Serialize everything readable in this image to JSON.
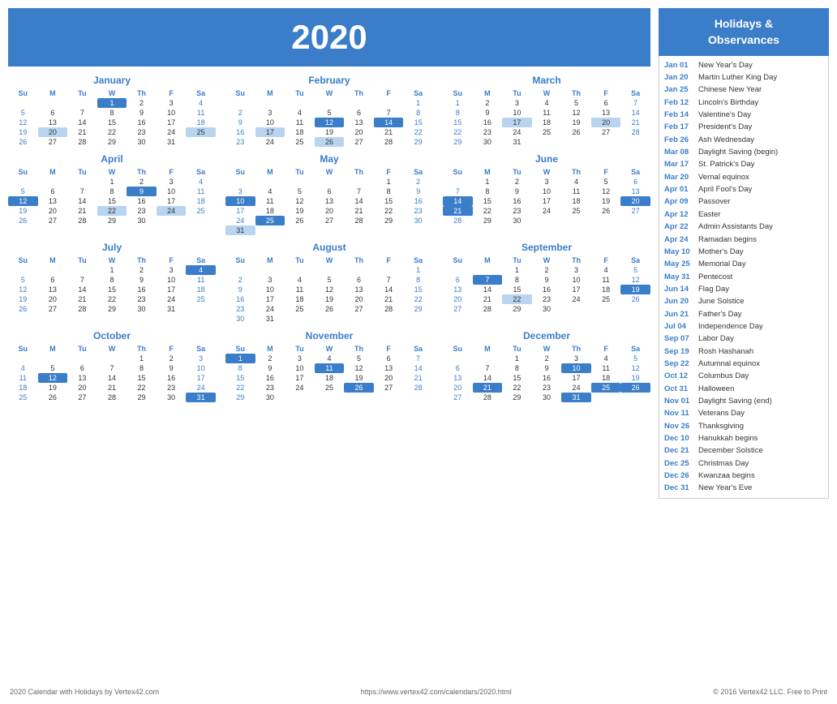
{
  "year": "2020",
  "months": [
    {
      "name": "January",
      "days": [
        {
          "week": [
            null,
            null,
            null,
            1,
            2,
            3,
            4
          ]
        },
        {
          "week": [
            5,
            6,
            7,
            8,
            9,
            10,
            11
          ]
        },
        {
          "week": [
            12,
            13,
            14,
            15,
            16,
            17,
            18
          ]
        },
        {
          "week": [
            19,
            20,
            21,
            22,
            23,
            24,
            25
          ]
        },
        {
          "week": [
            26,
            27,
            28,
            29,
            30,
            31,
            null
          ]
        }
      ],
      "highlights": {
        "blue": [
          1
        ],
        "light": [
          20,
          25
        ]
      }
    },
    {
      "name": "February",
      "days": [
        {
          "week": [
            null,
            null,
            null,
            null,
            null,
            null,
            1
          ]
        },
        {
          "week": [
            2,
            3,
            4,
            5,
            6,
            7,
            8
          ]
        },
        {
          "week": [
            9,
            10,
            11,
            12,
            13,
            14,
            15
          ]
        },
        {
          "week": [
            16,
            17,
            18,
            19,
            20,
            21,
            22
          ]
        },
        {
          "week": [
            23,
            24,
            25,
            26,
            27,
            28,
            29
          ]
        }
      ],
      "highlights": {
        "blue": [
          12,
          14
        ],
        "light": [
          17,
          26
        ]
      }
    },
    {
      "name": "March",
      "days": [
        {
          "week": [
            1,
            2,
            3,
            4,
            5,
            6,
            7
          ]
        },
        {
          "week": [
            8,
            9,
            10,
            11,
            12,
            13,
            14
          ]
        },
        {
          "week": [
            15,
            16,
            17,
            18,
            19,
            20,
            21
          ]
        },
        {
          "week": [
            22,
            23,
            24,
            25,
            26,
            27,
            28
          ]
        },
        {
          "week": [
            29,
            30,
            31,
            null,
            null,
            null,
            null
          ]
        }
      ],
      "highlights": {
        "blue": [],
        "light": [
          17,
          20
        ]
      }
    },
    {
      "name": "April",
      "days": [
        {
          "week": [
            null,
            null,
            null,
            1,
            2,
            3,
            4
          ]
        },
        {
          "week": [
            5,
            6,
            7,
            8,
            9,
            10,
            11
          ]
        },
        {
          "week": [
            12,
            13,
            14,
            15,
            16,
            17,
            18
          ]
        },
        {
          "week": [
            19,
            20,
            21,
            22,
            23,
            24,
            25
          ]
        },
        {
          "week": [
            26,
            27,
            28,
            29,
            30,
            null,
            null
          ]
        }
      ],
      "highlights": {
        "blue": [
          9,
          12
        ],
        "light": [
          22,
          24
        ]
      }
    },
    {
      "name": "May",
      "days": [
        {
          "week": [
            null,
            null,
            null,
            null,
            null,
            1,
            2
          ]
        },
        {
          "week": [
            3,
            4,
            5,
            6,
            7,
            8,
            9
          ]
        },
        {
          "week": [
            10,
            11,
            12,
            13,
            14,
            15,
            16
          ]
        },
        {
          "week": [
            17,
            18,
            19,
            20,
            21,
            22,
            23
          ]
        },
        {
          "week": [
            24,
            25,
            26,
            27,
            28,
            29,
            30
          ]
        },
        {
          "week": [
            31,
            null,
            null,
            null,
            null,
            null,
            null
          ]
        }
      ],
      "highlights": {
        "blue": [
          10,
          25
        ],
        "light": [
          31
        ]
      }
    },
    {
      "name": "June",
      "days": [
        {
          "week": [
            null,
            1,
            2,
            3,
            4,
            5,
            6
          ]
        },
        {
          "week": [
            7,
            8,
            9,
            10,
            11,
            12,
            13
          ]
        },
        {
          "week": [
            14,
            15,
            16,
            17,
            18,
            19,
            20
          ]
        },
        {
          "week": [
            21,
            22,
            23,
            24,
            25,
            26,
            27
          ]
        },
        {
          "week": [
            28,
            29,
            30,
            null,
            null,
            null,
            null
          ]
        }
      ],
      "highlights": {
        "blue": [
          14,
          20,
          21
        ],
        "light": []
      }
    },
    {
      "name": "July",
      "days": [
        {
          "week": [
            null,
            null,
            null,
            1,
            2,
            3,
            4
          ]
        },
        {
          "week": [
            5,
            6,
            7,
            8,
            9,
            10,
            11
          ]
        },
        {
          "week": [
            12,
            13,
            14,
            15,
            16,
            17,
            18
          ]
        },
        {
          "week": [
            19,
            20,
            21,
            22,
            23,
            24,
            25
          ]
        },
        {
          "week": [
            26,
            27,
            28,
            29,
            30,
            31,
            null
          ]
        }
      ],
      "highlights": {
        "blue": [
          4
        ],
        "light": []
      }
    },
    {
      "name": "August",
      "days": [
        {
          "week": [
            null,
            null,
            null,
            null,
            null,
            null,
            1
          ]
        },
        {
          "week": [
            2,
            3,
            4,
            5,
            6,
            7,
            8
          ]
        },
        {
          "week": [
            9,
            10,
            11,
            12,
            13,
            14,
            15
          ]
        },
        {
          "week": [
            16,
            17,
            18,
            19,
            20,
            21,
            22
          ]
        },
        {
          "week": [
            23,
            24,
            25,
            26,
            27,
            28,
            29
          ]
        },
        {
          "week": [
            30,
            31,
            null,
            null,
            null,
            null,
            null
          ]
        }
      ],
      "highlights": {
        "blue": [],
        "light": []
      }
    },
    {
      "name": "September",
      "days": [
        {
          "week": [
            null,
            null,
            1,
            2,
            3,
            4,
            5
          ]
        },
        {
          "week": [
            6,
            7,
            8,
            9,
            10,
            11,
            12
          ]
        },
        {
          "week": [
            13,
            14,
            15,
            16,
            17,
            18,
            19
          ]
        },
        {
          "week": [
            20,
            21,
            22,
            23,
            24,
            25,
            26
          ]
        },
        {
          "week": [
            27,
            28,
            29,
            30,
            null,
            null,
            null
          ]
        }
      ],
      "highlights": {
        "blue": [
          7,
          19
        ],
        "light": [
          22
        ]
      }
    },
    {
      "name": "October",
      "days": [
        {
          "week": [
            null,
            null,
            null,
            null,
            1,
            2,
            3
          ]
        },
        {
          "week": [
            4,
            5,
            6,
            7,
            8,
            9,
            10
          ]
        },
        {
          "week": [
            11,
            12,
            13,
            14,
            15,
            16,
            17
          ]
        },
        {
          "week": [
            18,
            19,
            20,
            21,
            22,
            23,
            24
          ]
        },
        {
          "week": [
            25,
            26,
            27,
            28,
            29,
            30,
            31
          ]
        }
      ],
      "highlights": {
        "blue": [
          12,
          31
        ],
        "light": []
      }
    },
    {
      "name": "November",
      "days": [
        {
          "week": [
            1,
            2,
            3,
            4,
            5,
            6,
            7
          ]
        },
        {
          "week": [
            8,
            9,
            10,
            11,
            12,
            13,
            14
          ]
        },
        {
          "week": [
            15,
            16,
            17,
            18,
            19,
            20,
            21
          ]
        },
        {
          "week": [
            22,
            23,
            24,
            25,
            26,
            27,
            28
          ]
        },
        {
          "week": [
            29,
            30,
            null,
            null,
            null,
            null,
            null
          ]
        }
      ],
      "highlights": {
        "blue": [
          1,
          11,
          26
        ],
        "light": [
          26
        ]
      }
    },
    {
      "name": "December",
      "days": [
        {
          "week": [
            null,
            null,
            1,
            2,
            3,
            4,
            5
          ]
        },
        {
          "week": [
            6,
            7,
            8,
            9,
            10,
            11,
            12
          ]
        },
        {
          "week": [
            13,
            14,
            15,
            16,
            17,
            18,
            19
          ]
        },
        {
          "week": [
            20,
            21,
            22,
            23,
            24,
            25,
            26
          ]
        },
        {
          "week": [
            27,
            28,
            29,
            30,
            31,
            null,
            null
          ]
        }
      ],
      "highlights": {
        "blue": [
          10,
          21,
          25,
          26,
          31
        ],
        "light": [
          25,
          26
        ]
      }
    }
  ],
  "holidays_header": "Holidays &\nObservances",
  "holidays": [
    {
      "date": "Jan 01",
      "name": "New Year's Day"
    },
    {
      "date": "Jan 20",
      "name": "Martin Luther King Day"
    },
    {
      "date": "Jan 25",
      "name": "Chinese New Year"
    },
    {
      "date": "Feb 12",
      "name": "Lincoln's Birthday"
    },
    {
      "date": "Feb 14",
      "name": "Valentine's Day"
    },
    {
      "date": "Feb 17",
      "name": "President's Day"
    },
    {
      "date": "Feb 26",
      "name": "Ash Wednesday"
    },
    {
      "date": "Mar 08",
      "name": "Daylight Saving (begin)"
    },
    {
      "date": "Mar 17",
      "name": "St. Patrick's Day"
    },
    {
      "date": "Mar 20",
      "name": "Vernal equinox"
    },
    {
      "date": "Apr 01",
      "name": "April Fool's Day"
    },
    {
      "date": "Apr 09",
      "name": "Passover"
    },
    {
      "date": "Apr 12",
      "name": "Easter"
    },
    {
      "date": "Apr 22",
      "name": "Admin Assistants Day"
    },
    {
      "date": "Apr 24",
      "name": "Ramadan begins"
    },
    {
      "date": "May 10",
      "name": "Mother's Day"
    },
    {
      "date": "May 25",
      "name": "Memorial Day"
    },
    {
      "date": "May 31",
      "name": "Pentecost"
    },
    {
      "date": "Jun 14",
      "name": "Flag Day"
    },
    {
      "date": "Jun 20",
      "name": "June Solstice"
    },
    {
      "date": "Jun 21",
      "name": "Father's Day"
    },
    {
      "date": "Jul 04",
      "name": "Independence Day"
    },
    {
      "date": "Sep 07",
      "name": "Labor Day"
    },
    {
      "date": "Sep 19",
      "name": "Rosh Hashanah"
    },
    {
      "date": "Sep 22",
      "name": "Autumnal equinox"
    },
    {
      "date": "Oct 12",
      "name": "Columbus Day"
    },
    {
      "date": "Oct 31",
      "name": "Halloween"
    },
    {
      "date": "Nov 01",
      "name": "Daylight Saving (end)"
    },
    {
      "date": "Nov 11",
      "name": "Veterans Day"
    },
    {
      "date": "Nov 26",
      "name": "Thanksgiving"
    },
    {
      "date": "Dec 10",
      "name": "Hanukkah begins"
    },
    {
      "date": "Dec 21",
      "name": "December Solstice"
    },
    {
      "date": "Dec 25",
      "name": "Christmas Day"
    },
    {
      "date": "Dec 26",
      "name": "Kwanzaa begins"
    },
    {
      "date": "Dec 31",
      "name": "New Year's Eve"
    }
  ],
  "footer": {
    "left": "2020 Calendar with Holidays by Vertex42.com",
    "center": "https://www.vertex42.com/calendars/2020.html",
    "right": "© 2016 Vertex42 LLC. Free to Print"
  },
  "weekdays": [
    "Su",
    "M",
    "Tu",
    "W",
    "Th",
    "F",
    "Sa"
  ]
}
